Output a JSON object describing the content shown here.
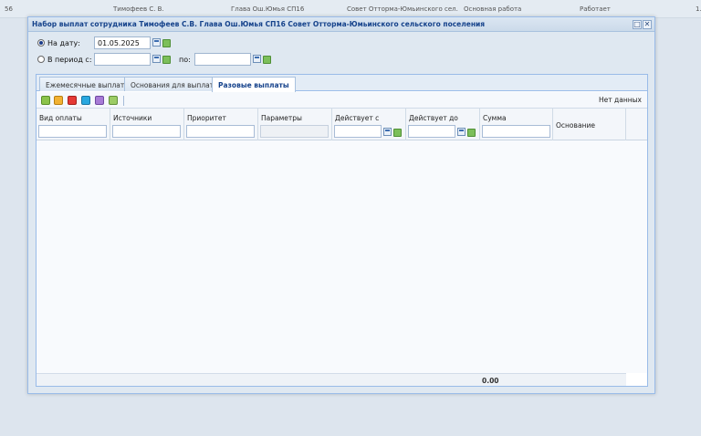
{
  "background_row": {
    "cells": [
      "56",
      "Тимофеев С. В.",
      "Глава Ош.Юмья СП16",
      "Совет Отторма-Юмьинского сел...",
      "Основная работа",
      "Работает",
      "1."
    ]
  },
  "window": {
    "title": "Набор выплат сотрудника Тимофеев С.В. Глава Ош.Юмья СП16 Совет Отторма-Юмьинского сельского поселения",
    "restore_icon": "□",
    "close_icon": "✕"
  },
  "filter": {
    "on_date_label": "На дату:",
    "on_date_value": "01.05.2025",
    "period_from_label": "В период с:",
    "period_from_value": "",
    "period_to_label": "по:",
    "period_to_value": "",
    "selected": "on_date"
  },
  "tabs": [
    {
      "label": "Ежемесячные выплаты",
      "active": false
    },
    {
      "label": "Основания для выплат",
      "active": false
    },
    {
      "label": "Разовые выплаты",
      "active": true
    }
  ],
  "toolbar": {
    "icons": [
      "add-icon",
      "edit-icon",
      "delete-icon",
      "copy-icon",
      "sum-icon",
      "refresh-icon"
    ],
    "status": "Нет данных"
  },
  "columns": [
    {
      "label": "Вид оплаты",
      "filter": true
    },
    {
      "label": "Источники",
      "filter": true
    },
    {
      "label": "Приоритет",
      "filter": true
    },
    {
      "label": "Параметры",
      "filter": "disabled"
    },
    {
      "label": "Действует с",
      "filter": "date"
    },
    {
      "label": "Действует до",
      "filter": "date"
    },
    {
      "label": "Сумма",
      "filter": true
    },
    {
      "label": "Основание",
      "filter": false
    }
  ],
  "footer": {
    "sum_total": "0.00"
  }
}
